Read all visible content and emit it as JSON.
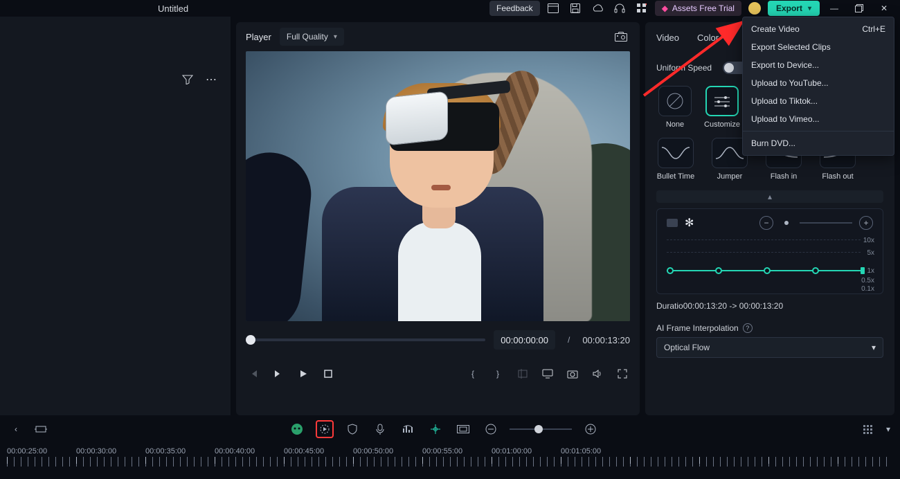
{
  "title": "Untitled",
  "topbar": {
    "feedback": "Feedback",
    "assets_trial": "Assets Free Trial",
    "export": "Export"
  },
  "export_menu": {
    "create_video": "Create Video",
    "create_video_shortcut": "Ctrl+E",
    "export_selected": "Export Selected Clips",
    "export_device": "Export to Device...",
    "upload_youtube": "Upload to YouTube...",
    "upload_tiktok": "Upload to Tiktok...",
    "upload_vimeo": "Upload to Vimeo...",
    "burn_dvd": "Burn DVD..."
  },
  "player": {
    "label": "Player",
    "quality": "Full Quality",
    "current_time": "00:00:00:00",
    "separator": "/",
    "duration": "00:00:13:20"
  },
  "right": {
    "tabs": {
      "video": "Video",
      "color": "Color"
    },
    "uniform_speed": "Uniform Speed",
    "presets": {
      "none": "None",
      "customize": "Customize"
    },
    "curves": {
      "bullet_time": "Bullet Time",
      "jumper": "Jumper",
      "flash_in": "Flash in",
      "flash_out": "Flash out"
    },
    "scale": {
      "x10": "10x",
      "x5": "5x",
      "x1": "1x",
      "x05": "0.5x",
      "x01": "0.1x"
    },
    "duration_prefix": "Duratio",
    "duration_from": "00:00:13:20",
    "duration_arrow": " -> ",
    "duration_to": "00:00:13:20",
    "ai_fi": "AI Frame Interpolation",
    "optical_flow": "Optical Flow"
  },
  "ruler": [
    "00:00:25:00",
    "00:00:30:00",
    "00:00:35:00",
    "00:00:40:00",
    "00:00:45:00",
    "00:00:50:00",
    "00:00:55:00",
    "00:01:00:00",
    "00:01:05:00"
  ]
}
